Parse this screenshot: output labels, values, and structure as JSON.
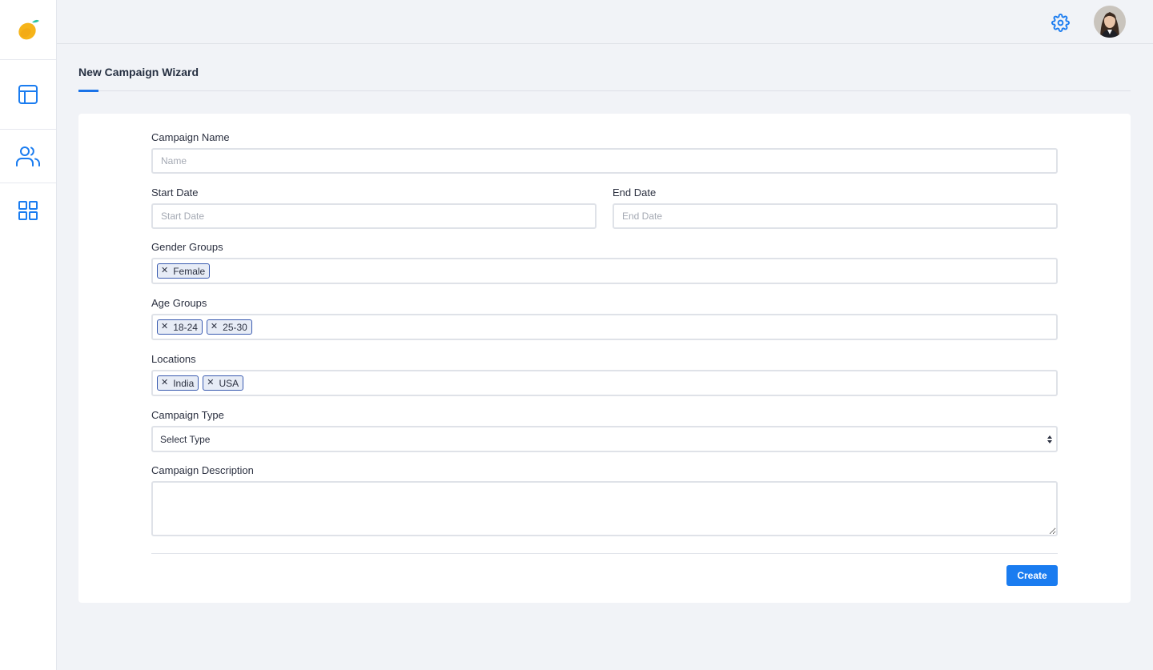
{
  "nav": {
    "logo": "mango-logo",
    "items": [
      {
        "name": "dashboard",
        "icon": "layout-icon"
      },
      {
        "name": "users",
        "icon": "users-icon"
      },
      {
        "name": "apps",
        "icon": "grid-icon"
      }
    ]
  },
  "topbar": {
    "settings_icon": "gear-icon",
    "avatar": "user-avatar"
  },
  "page": {
    "title": "New Campaign Wizard"
  },
  "form": {
    "campaign_name": {
      "label": "Campaign Name",
      "placeholder": "Name"
    },
    "start_date": {
      "label": "Start Date",
      "placeholder": "Start Date"
    },
    "end_date": {
      "label": "End Date",
      "placeholder": "End Date"
    },
    "gender_groups": {
      "label": "Gender Groups",
      "tags": [
        "Female"
      ]
    },
    "age_groups": {
      "label": "Age Groups",
      "tags": [
        "18-24",
        "25-30"
      ]
    },
    "locations": {
      "label": "Locations",
      "tags": [
        "India",
        "USA"
      ]
    },
    "campaign_type": {
      "label": "Campaign Type",
      "selected": "Select Type"
    },
    "campaign_description": {
      "label": "Campaign Description",
      "value": ""
    },
    "submit_label": "Create"
  },
  "colors": {
    "accent": "#1a7cf0",
    "background": "#f1f3f7",
    "tag_border": "#3a5bb0"
  }
}
